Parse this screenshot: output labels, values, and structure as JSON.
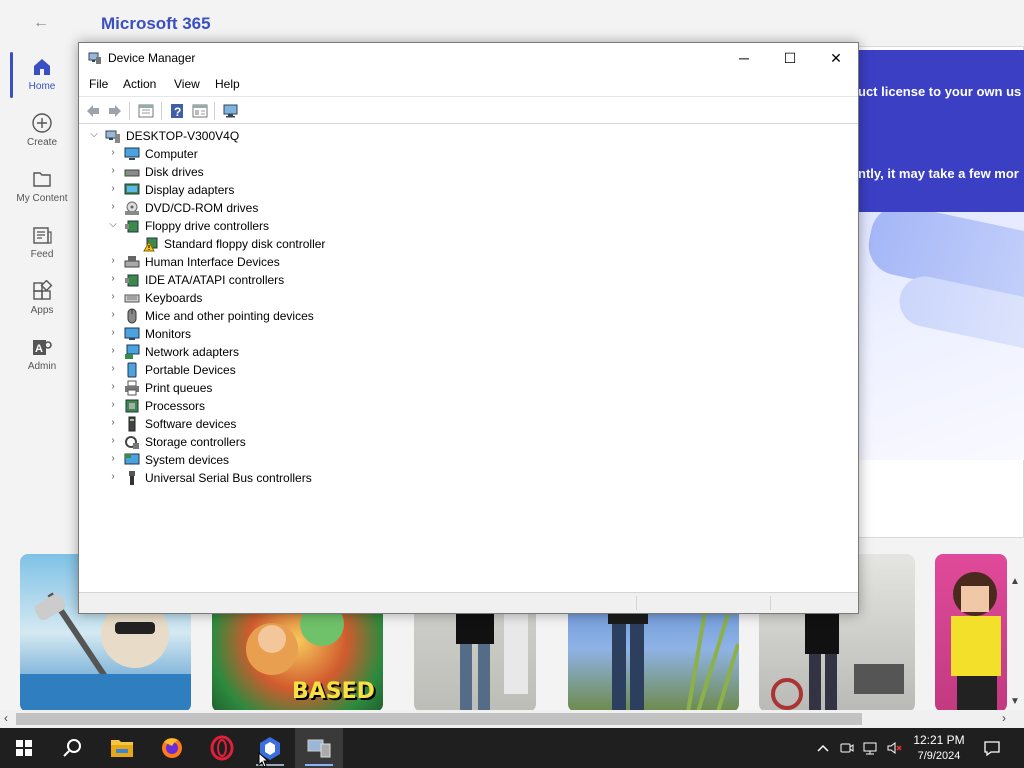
{
  "m365": {
    "title": "Microsoft 365",
    "rail": [
      {
        "label": "Home",
        "icon": "home-icon"
      },
      {
        "label": "Create",
        "icon": "plus-circle-icon"
      },
      {
        "label": "My Content",
        "icon": "folder-icon"
      },
      {
        "label": "Feed",
        "icon": "feed-icon"
      },
      {
        "label": "Apps",
        "icon": "apps-icon"
      },
      {
        "label": "Admin",
        "icon": "admin-icon"
      }
    ],
    "banner_line1": "uct license to your own us",
    "banner_line2": "ntly, it may take a few mor",
    "thumb_text": "BASED"
  },
  "device_manager": {
    "title": "Device Manager",
    "menu": [
      "File",
      "Action",
      "View",
      "Help"
    ],
    "window_buttons": {
      "minimize": "─",
      "maximize": "☐",
      "close": "✕"
    },
    "root": "DESKTOP-V300V4Q",
    "categories": [
      {
        "label": "Computer",
        "icon": "computer-icon",
        "expanded": false
      },
      {
        "label": "Disk drives",
        "icon": "disk-drive-icon",
        "expanded": false
      },
      {
        "label": "Display adapters",
        "icon": "display-adapter-icon",
        "expanded": false
      },
      {
        "label": "DVD/CD-ROM drives",
        "icon": "dvd-drive-icon",
        "expanded": false
      },
      {
        "label": "Floppy drive controllers",
        "icon": "floppy-controller-icon",
        "expanded": true,
        "children": [
          {
            "label": "Standard floppy disk controller",
            "icon": "warning-device-icon"
          }
        ]
      },
      {
        "label": "Human Interface Devices",
        "icon": "hid-icon",
        "expanded": false
      },
      {
        "label": "IDE ATA/ATAPI controllers",
        "icon": "ide-controller-icon",
        "expanded": false
      },
      {
        "label": "Keyboards",
        "icon": "keyboard-icon",
        "expanded": false
      },
      {
        "label": "Mice and other pointing devices",
        "icon": "mouse-icon",
        "expanded": false
      },
      {
        "label": "Monitors",
        "icon": "monitor-icon",
        "expanded": false
      },
      {
        "label": "Network adapters",
        "icon": "network-adapter-icon",
        "expanded": false
      },
      {
        "label": "Portable Devices",
        "icon": "portable-device-icon",
        "expanded": false
      },
      {
        "label": "Print queues",
        "icon": "printer-icon",
        "expanded": false
      },
      {
        "label": "Processors",
        "icon": "processor-icon",
        "expanded": false
      },
      {
        "label": "Software devices",
        "icon": "software-device-icon",
        "expanded": false
      },
      {
        "label": "Storage controllers",
        "icon": "storage-controller-icon",
        "expanded": false
      },
      {
        "label": "System devices",
        "icon": "system-device-icon",
        "expanded": false
      },
      {
        "label": "Universal Serial Bus controllers",
        "icon": "usb-icon",
        "expanded": false
      }
    ]
  },
  "taskbar": {
    "apps": [
      "start-icon",
      "search-icon",
      "file-explorer-icon",
      "firefox-icon",
      "opera-icon",
      "copilot-icon",
      "device-manager-icon"
    ],
    "time": "12:21 PM",
    "date": "7/9/2024"
  },
  "colors": {
    "accent": "#3b4fc4",
    "banner": "#3b3fc4",
    "taskbar": "#1f1f1f"
  }
}
